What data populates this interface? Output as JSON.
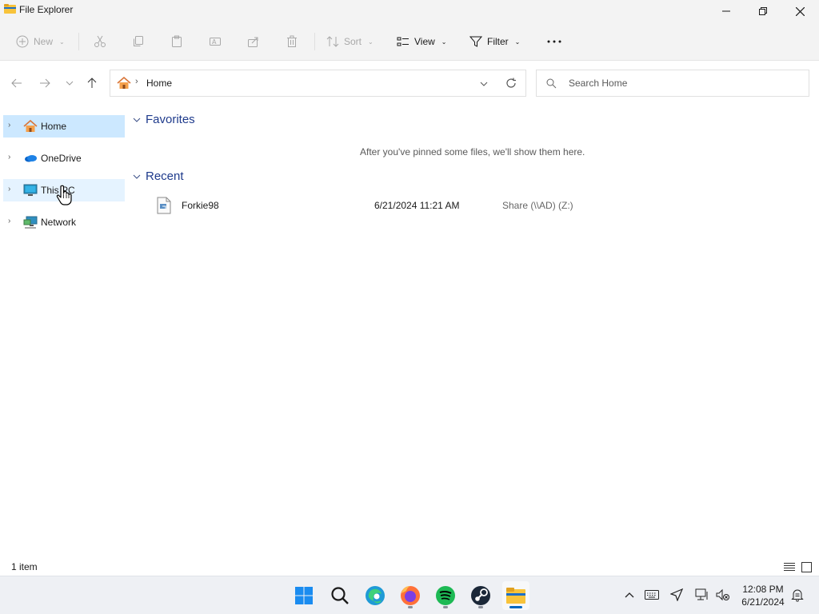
{
  "window": {
    "title": "File Explorer"
  },
  "commands": {
    "new": "New",
    "sort": "Sort",
    "view": "View",
    "filter": "Filter"
  },
  "address": {
    "location": "Home"
  },
  "search": {
    "placeholder": "Search Home"
  },
  "sidebar": {
    "items": [
      {
        "label": "Home",
        "icon": "home-icon",
        "state": "selected"
      },
      {
        "label": "OneDrive",
        "icon": "onedrive-icon",
        "state": "normal"
      },
      {
        "label": "This PC",
        "icon": "this-pc-icon",
        "state": "hover"
      },
      {
        "label": "Network",
        "icon": "network-icon",
        "state": "normal"
      }
    ]
  },
  "main": {
    "favorites": {
      "title": "Favorites",
      "empty_message": "After you've pinned some files, we'll show them here."
    },
    "recent": {
      "title": "Recent",
      "files": [
        {
          "name": "Forkie98",
          "date": "6/21/2024 11:21 AM",
          "location": "Share (\\\\AD) (Z:)"
        }
      ]
    }
  },
  "status": {
    "count": "1 item"
  },
  "taskbar": {
    "apps": [
      "start",
      "search",
      "edge",
      "firefox",
      "spotify",
      "steam",
      "file-explorer"
    ],
    "time": "12:08 PM",
    "date": "6/21/2024"
  },
  "colors": {
    "selected": "#cce8ff",
    "hover": "#e5f3ff",
    "section_title": "#1f3b8c",
    "accent": "#0067c0"
  }
}
